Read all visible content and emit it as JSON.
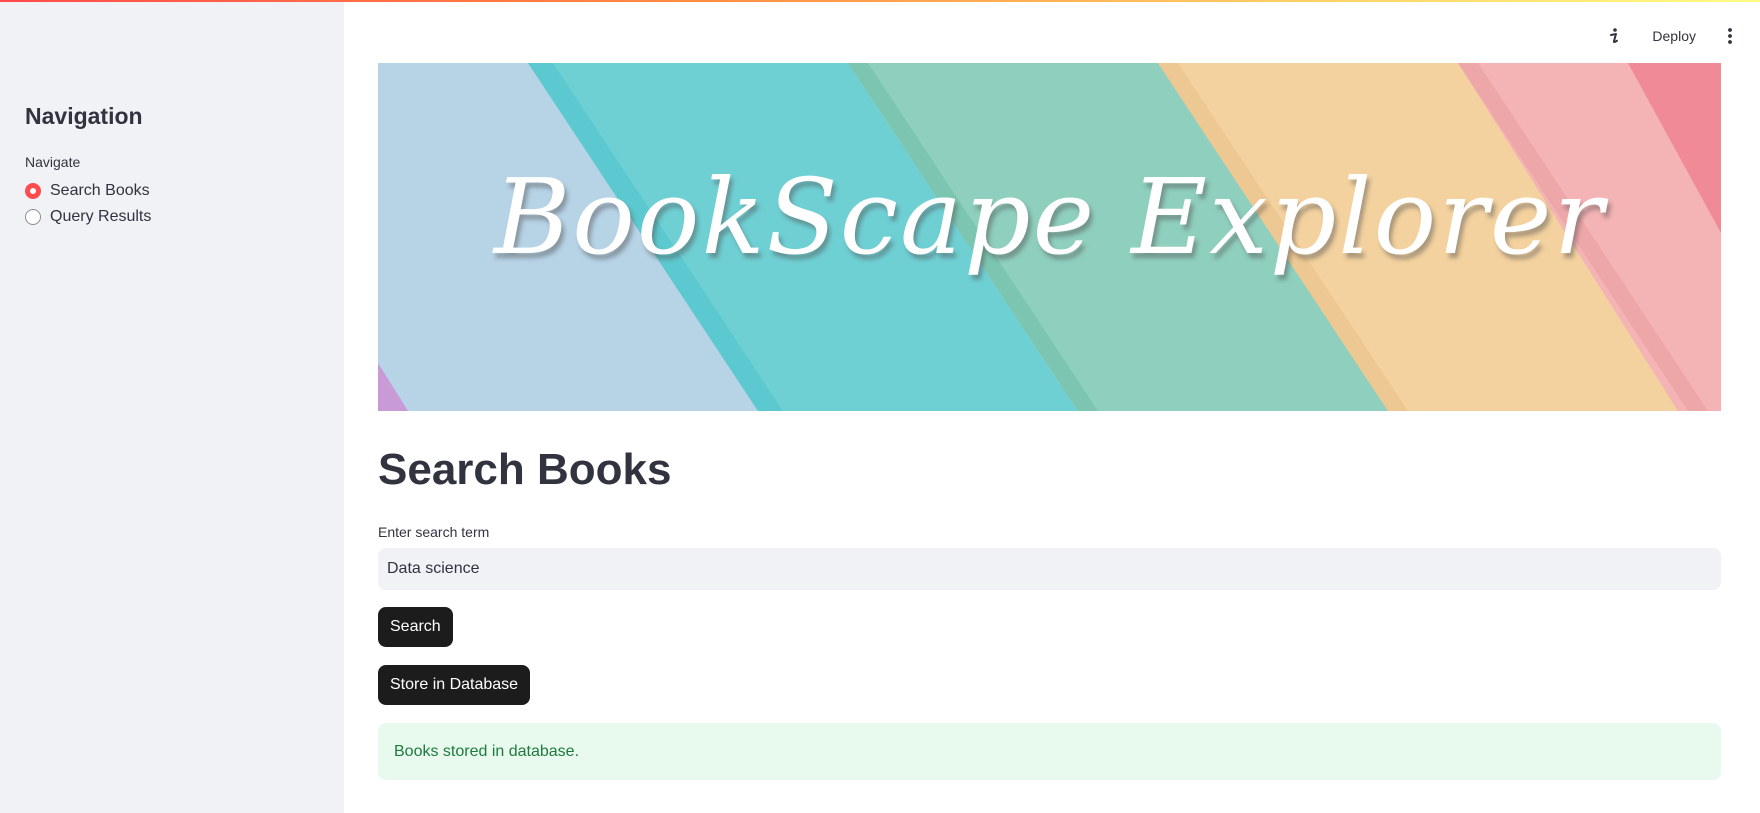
{
  "sidebar": {
    "title": "Navigation",
    "radio_group_label": "Navigate",
    "options": [
      {
        "label": "Search Books",
        "selected": true
      },
      {
        "label": "Query Results",
        "selected": false
      }
    ]
  },
  "header": {
    "deploy_label": "Deploy",
    "icons": [
      "info-icon",
      "more-vertical-icon"
    ]
  },
  "banner": {
    "title": "BookScape Explorer"
  },
  "main": {
    "page_title": "Search Books",
    "search": {
      "label": "Enter search term",
      "value": "Data science"
    },
    "search_button_label": "Search",
    "store_button_label": "Store in Database",
    "success_message": "Books stored in database."
  },
  "colors": {
    "accent": "#ff4b4b",
    "sidebar_bg": "#f0f2f6",
    "button_bg": "#1c1c1c",
    "success_bg": "#e8f9ee",
    "success_text": "#1f7a3e"
  }
}
